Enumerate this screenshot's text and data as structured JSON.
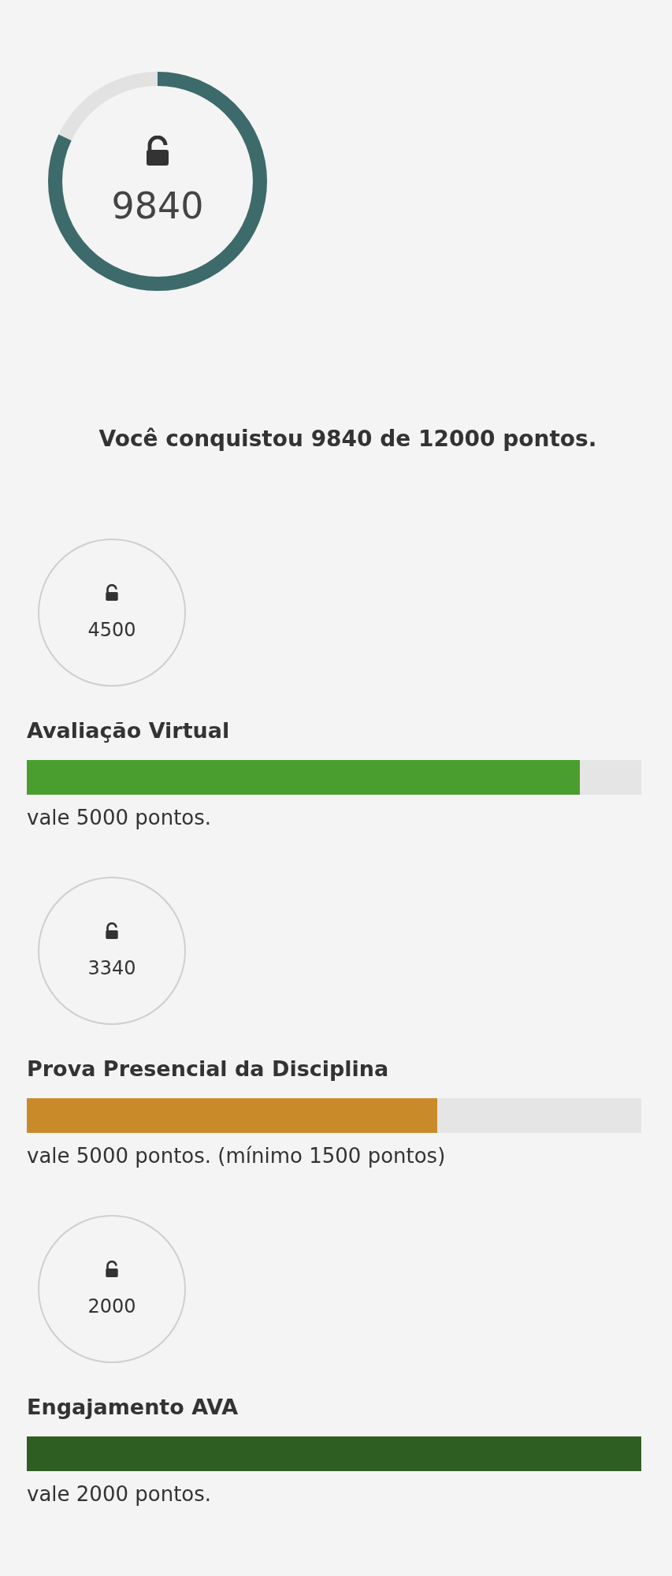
{
  "total": {
    "value": "9840",
    "level": 0.82
  },
  "summary": "Você conquistou 9840 de 12000 pontos.",
  "items": [
    {
      "value": "4500",
      "title": "Avaliação Virtual",
      "level": 0.9,
      "color": "#4a9e2f",
      "note": "vale 5000 pontos."
    },
    {
      "value": "3340",
      "title": "Prova Presencial da Disciplina",
      "level": 0.668,
      "color": "#c98a2a",
      "note": "vale 5000 pontos. (mínimo 1500 pontos)"
    },
    {
      "value": "2000",
      "title": "Engajamento AVA",
      "level": 1,
      "color": "#2f5e22",
      "note": "vale 2000 pontos."
    }
  ]
}
